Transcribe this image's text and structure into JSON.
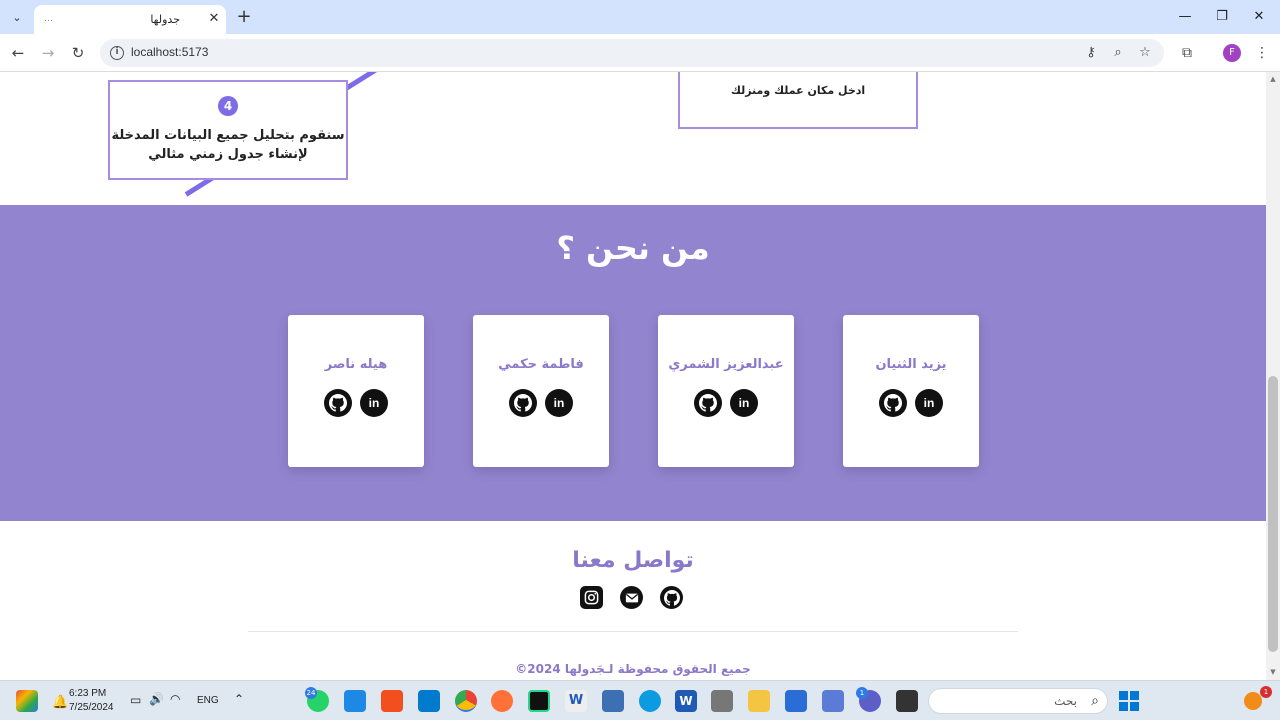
{
  "browser": {
    "tab_title": "جدولها",
    "url": "localhost:5173",
    "profile_initial": "F"
  },
  "steps": {
    "step4_number": "4",
    "step4_line1": "سنقوم بتحليل جميع البيانات المدخلة",
    "step4_line2": "لإنشاء جدول زمني مثالي",
    "step3_text": "ادخل مكان عملك ومنزلك"
  },
  "about": {
    "title": "من نحن ؟",
    "members": [
      {
        "name": "يزيد الثنيان"
      },
      {
        "name": "عبدالعزيز الشمري"
      },
      {
        "name": "فاطمة حكمي"
      },
      {
        "name": "هيله ناصر"
      }
    ]
  },
  "contact": {
    "title": "تواصل معنا",
    "copyright": "جميع الحقوق محفوظة لـجَدولها 2024©"
  },
  "taskbar": {
    "time": "6:23 PM",
    "date": "7/25/2024",
    "lang": "ENG",
    "search_label": "بحث",
    "whatsapp_badge": "24",
    "teams_badge": "1",
    "notif_badge": "1"
  },
  "colors": {
    "accent": "#9384cf",
    "accent_text": "#8a78c8",
    "step_border": "#a98be0",
    "step_number": "#7e6be8"
  }
}
